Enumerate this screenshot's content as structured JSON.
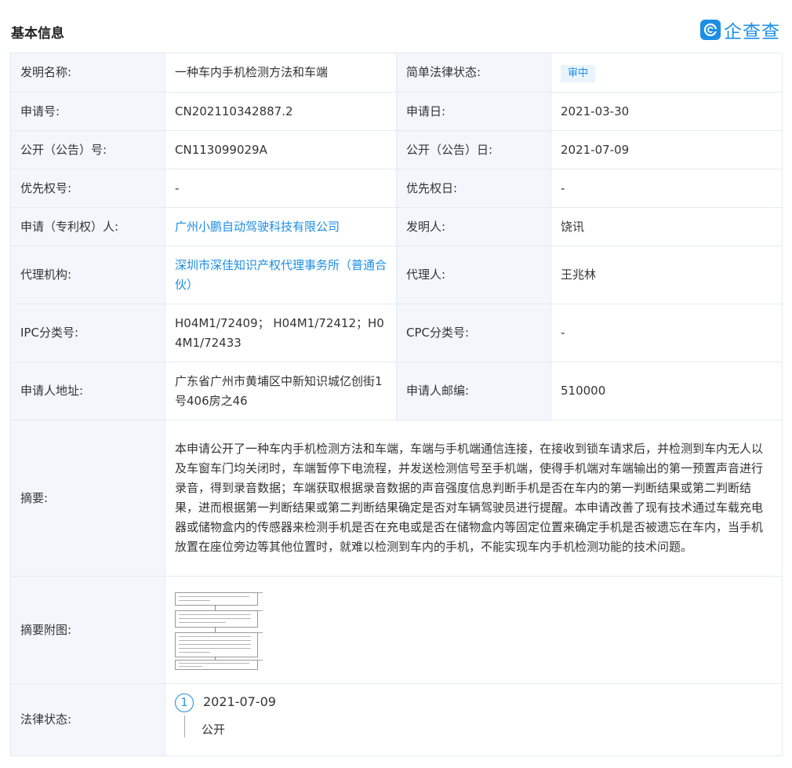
{
  "section_title": "基本信息",
  "logo_text": "企查查",
  "labels": {
    "invention_name": "发明名称:",
    "legal_status_simple": "简单法律状态:",
    "app_no": "申请号:",
    "app_date": "申请日:",
    "pub_no": "公开（公告）号:",
    "pub_date": "公开（公告）日:",
    "priority_no": "优先权号:",
    "priority_date": "优先权日:",
    "applicant": "申请（专利权）人:",
    "inventor": "发明人:",
    "agency": "代理机构:",
    "agent": "代理人:",
    "ipc": "IPC分类号:",
    "cpc": "CPC分类号:",
    "address": "申请人地址:",
    "postcode": "申请人邮编:",
    "abstract": "摘要:",
    "abstract_fig": "摘要附图:",
    "legal_status": "法律状态:"
  },
  "values": {
    "invention_name": "一种车内手机检测方法和车端",
    "legal_status_simple": "审中",
    "app_no": "CN202110342887.2",
    "app_date": "2021-03-30",
    "pub_no": "CN113099029A",
    "pub_date": "2021-07-09",
    "priority_no": "-",
    "priority_date": "-",
    "applicant": "广州小鹏自动驾驶科技有限公司",
    "inventor": "饶讯",
    "agency": "深圳市深佳知识产权代理事务所（普通合伙）",
    "agent": "王兆林",
    "ipc": "H04M1/72409； H04M1/72412；H04M1/72433",
    "cpc": "-",
    "address": "广东省广州市黄埔区中新知识城亿创街1号406房之46",
    "postcode": "510000",
    "abstract": "本申请公开了一种车内手机检测方法和车端，车端与手机端通信连接，在接收到锁车请求后，并检测到车内无人以及车窗车门均关闭时，车端暂停下电流程，并发送检测信号至手机端，使得手机端对车端输出的第一预置声音进行录音，得到录音数据；车端获取根据录音数据的声音强度信息判断手机是否在车内的第一判断结果或第二判断结果，进而根据第一判断结果或第二判断结果确定是否对车辆驾驶员进行提醒。本申请改善了现有技术通过车载充电器或储物盒内的传感器来检测手机是否在充电或是否在储物盒内等固定位置来确定手机是否被遗忘在车内，当手机放置在座位旁边等其他位置时，就难以检测到车内的手机，不能实现车内手机检测功能的技术问题。"
  },
  "legal_events": [
    {
      "index": "1",
      "date": "2021-07-09",
      "status": "公开"
    }
  ],
  "colors": {
    "accent": "#1c8ee6",
    "label_bg": "#f3f7fc",
    "border": "#e4eaf0"
  }
}
